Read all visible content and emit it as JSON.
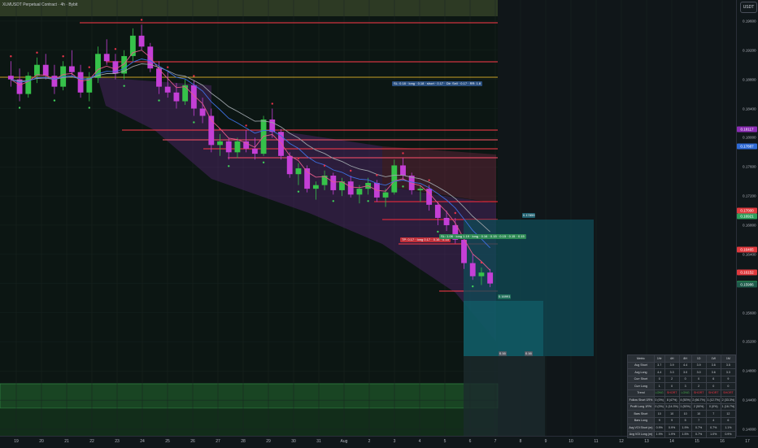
{
  "header": {
    "symbol_title": "XLMUSDT Perpetual Contract · 4h · Bybit"
  },
  "price_axis": {
    "currency": "USDT",
    "ticks": [
      "0.19600",
      "0.19200",
      "0.18800",
      "0.18400",
      "0.18000",
      "0.17600",
      "0.17200",
      "0.16800",
      "0.16400",
      "0.16000",
      "0.15600",
      "0.15200",
      "0.14800",
      "0.14400",
      "0.14000"
    ],
    "tags": [
      {
        "label": "0.18117",
        "color": "#8b2cb3",
        "value": 0.18117
      },
      {
        "label": "0.17887",
        "color": "#2f6bd6",
        "value": 0.17887
      },
      {
        "label": "0.17000",
        "color": "#e03a3e",
        "value": 0.17
      },
      {
        "label": "0.16921",
        "color": "#2e9e5b",
        "value": 0.16921
      },
      {
        "label": "0.16465",
        "color": "#e03a3e",
        "value": 0.16465
      },
      {
        "label": "0.16152",
        "color": "#e03a3e",
        "value": 0.16152
      },
      {
        "label": "0.16002",
        "color": "#2e9e5b",
        "value": 0.16002
      },
      {
        "label": "0.15986",
        "color": "#1e5a4a",
        "value": 0.15986
      }
    ]
  },
  "time_axis": {
    "labels": [
      "19",
      "20",
      "21",
      "22",
      "23",
      "24",
      "25",
      "26",
      "27",
      "28",
      "29",
      "30",
      "31",
      "Aug",
      "2",
      "3",
      "4",
      "5",
      "6",
      "7",
      "8",
      "9",
      "10",
      "11",
      "12",
      "13",
      "14",
      "15",
      "16",
      "17"
    ]
  },
  "annotations": {
    "blue_callout": "SL: 0.18 · long · 0.18 · short · 0.17 · Dir: Sell · 0.17 · RR: 1.8",
    "red_callout": "TP: 0.17 · long 0.17 · 0.16 · 0.15",
    "green_callout": "SL: 1.08 · long 1.19 · long · 0.16 · 0.15 · 0.15 · 0.15 · 0.15",
    "level_tags": [
      "0.17859",
      "0.16991",
      "0.16",
      "0.16"
    ]
  },
  "stats_table": {
    "headers": [
      "Metric",
      "1Hr",
      "4H",
      "8H",
      "1D",
      "1W",
      "1M"
    ],
    "rows": [
      {
        "label": "Avg Short",
        "cells": [
          "3.7",
          "3.9",
          "4.4",
          "3.9",
          "3.6",
          "3.5"
        ]
      },
      {
        "label": "Avg Long",
        "cells": [
          "4.4",
          "3.3",
          "3.0",
          "3.0",
          "3.6",
          "3.3"
        ]
      },
      {
        "label": "Curr Short",
        "cells": [
          "0",
          "2",
          "0",
          "0",
          "6",
          "9"
        ]
      },
      {
        "label": "Curr Long",
        "cells": [
          "1",
          "0",
          "3",
          "2",
          "0",
          "0"
        ]
      },
      {
        "label": "Trend",
        "cells": [
          "LONG",
          "SHORT",
          "LONG",
          "SHORT",
          "SHORT",
          "SHORT"
        ]
      },
      {
        "label": "Follow Short 1R%",
        "cells": [
          "0 (0%)",
          "8 (47%)",
          "4 (50%)",
          "2 (66.7%)",
          "1 (12.7%)",
          "2 (33.3%)"
        ]
      },
      {
        "label": "Profit Long 1R%",
        "cells": [
          "0 (0%)",
          "1 (14.3%)",
          "1 (50%)",
          "2 (50%)",
          "0 (0%)",
          "1 (16.7%)"
        ]
      },
      {
        "label": "Bars Short",
        "cells": [
          "10",
          "10",
          "10",
          "10",
          "7",
          "12"
        ]
      },
      {
        "label": "Bars Long",
        "cells": [
          "9",
          "9",
          "5",
          "7",
          "4",
          "6"
        ]
      },
      {
        "label": "Avg VOl Short (m)",
        "cells": [
          "0.9%",
          "0.9%",
          "1.9%",
          "0.7%",
          "0.7%",
          "1.1%"
        ]
      },
      {
        "label": "Avg VOl Long (m)",
        "cells": [
          "1.9%",
          "1.9%",
          "1.5%",
          "0.7%",
          "1.0%",
          "0.9%"
        ]
      }
    ]
  },
  "chart_data": {
    "type": "candlestick",
    "title": "XLMUSDT Perpetual Contract · 4h · Bybit",
    "ylim": [
      0.14,
      0.198
    ],
    "x_start_label": "19",
    "candles_ohlc": [
      [
        0.1885,
        0.1905,
        0.187,
        0.188
      ],
      [
        0.188,
        0.1895,
        0.185,
        0.186
      ],
      [
        0.186,
        0.189,
        0.1855,
        0.1885
      ],
      [
        0.1885,
        0.191,
        0.1875,
        0.19
      ],
      [
        0.19,
        0.1915,
        0.188,
        0.1885
      ],
      [
        0.1885,
        0.19,
        0.186,
        0.187
      ],
      [
        0.187,
        0.1905,
        0.1865,
        0.1898
      ],
      [
        0.1898,
        0.192,
        0.1885,
        0.189
      ],
      [
        0.189,
        0.19,
        0.1855,
        0.1862
      ],
      [
        0.1862,
        0.189,
        0.185,
        0.1882
      ],
      [
        0.1882,
        0.1925,
        0.1875,
        0.1915
      ],
      [
        0.1915,
        0.1935,
        0.19,
        0.1905
      ],
      [
        0.1905,
        0.1915,
        0.188,
        0.1888
      ],
      [
        0.1888,
        0.192,
        0.188,
        0.1912
      ],
      [
        0.1912,
        0.195,
        0.1905,
        0.194
      ],
      [
        0.194,
        0.1955,
        0.192,
        0.1925
      ],
      [
        0.1925,
        0.193,
        0.189,
        0.1895
      ],
      [
        0.1895,
        0.1905,
        0.186,
        0.187
      ],
      [
        0.187,
        0.189,
        0.1855,
        0.1862
      ],
      [
        0.1862,
        0.1875,
        0.184,
        0.185
      ],
      [
        0.185,
        0.188,
        0.1845,
        0.1872
      ],
      [
        0.1872,
        0.1878,
        0.183,
        0.184
      ],
      [
        0.184,
        0.1855,
        0.182,
        0.183
      ],
      [
        0.183,
        0.184,
        0.178,
        0.179
      ],
      [
        0.179,
        0.1805,
        0.1775,
        0.1795
      ],
      [
        0.1795,
        0.18,
        0.177,
        0.178
      ],
      [
        0.178,
        0.18,
        0.1772,
        0.1795
      ],
      [
        0.1795,
        0.181,
        0.178,
        0.1785
      ],
      [
        0.1785,
        0.18,
        0.177,
        0.1778
      ],
      [
        0.1778,
        0.183,
        0.1775,
        0.1825
      ],
      [
        0.1825,
        0.184,
        0.18,
        0.1808
      ],
      [
        0.1808,
        0.1812,
        0.177,
        0.1775
      ],
      [
        0.1775,
        0.178,
        0.1745,
        0.175
      ],
      [
        0.175,
        0.1765,
        0.1735,
        0.1758
      ],
      [
        0.1758,
        0.1762,
        0.1725,
        0.173
      ],
      [
        0.173,
        0.174,
        0.1715,
        0.1735
      ],
      [
        0.1735,
        0.1755,
        0.1728,
        0.1748
      ],
      [
        0.1748,
        0.1752,
        0.1722,
        0.1728
      ],
      [
        0.1728,
        0.1745,
        0.172,
        0.174
      ],
      [
        0.174,
        0.1748,
        0.1718,
        0.1722
      ],
      [
        0.1722,
        0.1735,
        0.171,
        0.173
      ],
      [
        0.173,
        0.1745,
        0.1722,
        0.1738
      ],
      [
        0.1738,
        0.1742,
        0.1712,
        0.1718
      ],
      [
        0.1718,
        0.173,
        0.1705,
        0.1725
      ],
      [
        0.1725,
        0.177,
        0.1722,
        0.1762
      ],
      [
        0.1762,
        0.1772,
        0.1742,
        0.1748
      ],
      [
        0.1748,
        0.1752,
        0.1722,
        0.1728
      ],
      [
        0.1728,
        0.1735,
        0.1712,
        0.173
      ],
      [
        0.173,
        0.1735,
        0.17,
        0.1708
      ],
      [
        0.1708,
        0.1712,
        0.168,
        0.169
      ],
      [
        0.169,
        0.17,
        0.1672,
        0.168
      ],
      [
        0.168,
        0.169,
        0.1655,
        0.166
      ],
      [
        0.166,
        0.1668,
        0.162,
        0.1628
      ],
      [
        0.1628,
        0.164,
        0.1605,
        0.161
      ],
      [
        0.161,
        0.1622,
        0.1598,
        0.1615
      ],
      [
        0.1615,
        0.162,
        0.1595,
        0.16
      ]
    ],
    "ema_lines": [
      {
        "name": "",
        "color": "#e05a8a"
      },
      {
        "name": "",
        "color": "#9aa0a6"
      },
      {
        "name": "",
        "color": "#3d6fe0"
      }
    ]
  }
}
